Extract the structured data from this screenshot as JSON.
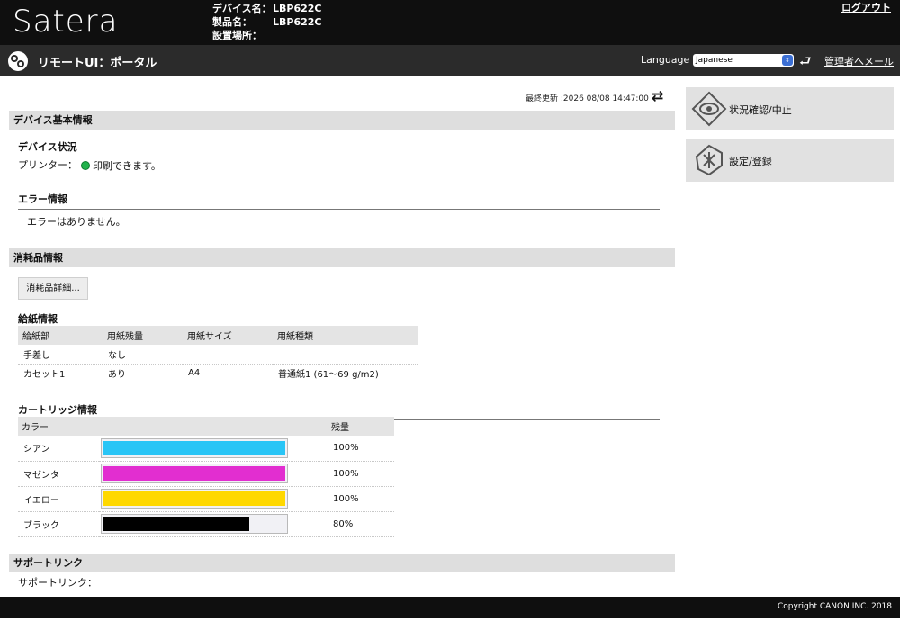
{
  "header": {
    "brand": "Satera",
    "device_name_label": "デバイス名：",
    "device_name": "LBP622C",
    "product_name_label": "製品名：",
    "product_name": "LBP622C",
    "location_label": "設置場所：",
    "location": "",
    "logout": "ログアウト"
  },
  "subbar": {
    "title": "リモートUI：ポータル",
    "language_label": "Language :",
    "language_value": "Japanese",
    "admin_mail": "管理者へメール"
  },
  "status": {
    "last_updated": "最終更新 :2026 08/08 14:47:00"
  },
  "device_info": {
    "section_title": "デバイス基本情報",
    "status_heading": "デバイス状況",
    "printer_label": "プリンター：",
    "printer_status": "印刷できます。",
    "error_heading": "エラー情報",
    "error_text": "エラーはありません。"
  },
  "consumables": {
    "section_title": "消耗品情報",
    "details_button": "消耗品詳細...",
    "paper_heading": "給紙情報",
    "paper_columns": [
      "給紙部",
      "用紙残量",
      "用紙サイズ",
      "用紙種類"
    ],
    "paper_rows": [
      [
        "手差し",
        "なし",
        "",
        ""
      ],
      [
        "カセット1",
        "あり",
        "A4",
        "普通紙1 (61～69 g/m2)"
      ]
    ],
    "cartridge_heading": "カートリッジ情報",
    "cartridge_columns": [
      "カラー",
      "",
      "残量"
    ],
    "cartridges": [
      {
        "name": "シアン",
        "level": 1.0,
        "label": "100%",
        "color": "#29c5f6"
      },
      {
        "name": "マゼンタ",
        "level": 1.0,
        "label": "100%",
        "color": "#e22ed0"
      },
      {
        "name": "イエロー",
        "level": 1.0,
        "label": "100%",
        "color": "#ffd800"
      },
      {
        "name": "ブラック",
        "level": 0.8,
        "label": "80%",
        "color": "#000000"
      }
    ]
  },
  "support": {
    "section_title": "サポートリンク",
    "link_label": "サポートリンク："
  },
  "side": {
    "status_monitor": "状況確認/中止",
    "settings": "設定/登録"
  },
  "footer": {
    "copyright": "Copyright CANON INC. 2018"
  }
}
